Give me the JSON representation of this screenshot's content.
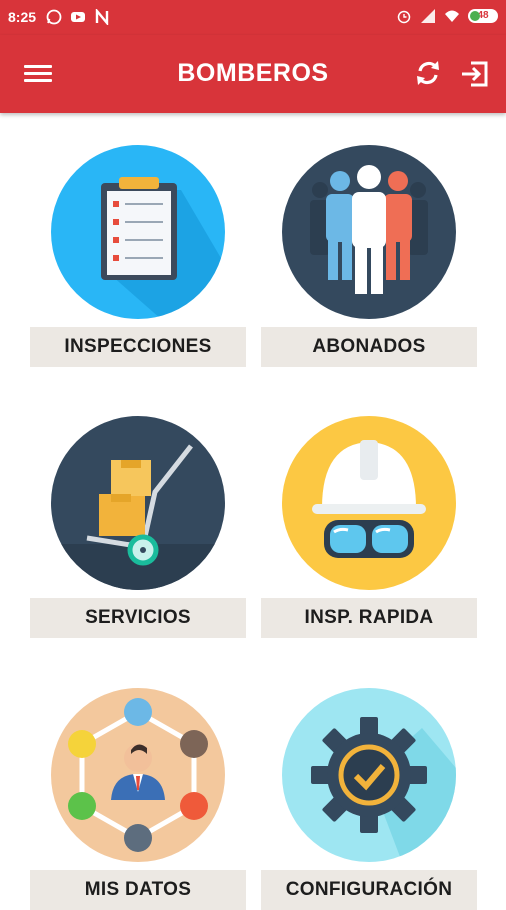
{
  "status_bar": {
    "time": "8:25",
    "battery": "48"
  },
  "app_bar": {
    "title": "BOMBEROS"
  },
  "tiles": [
    {
      "label": "INSPECCIONES",
      "icon": "clipboard-icon",
      "color": "#29b6f6"
    },
    {
      "label": "ABONADOS",
      "icon": "people-group-icon",
      "color": "#34495e"
    },
    {
      "label": "SERVICIOS",
      "icon": "hand-truck-icon",
      "color": "#34495e"
    },
    {
      "label": "INSP. RAPIDA",
      "icon": "helmet-goggles-icon",
      "color": "#fcc843"
    },
    {
      "label": "MIS DATOS",
      "icon": "user-network-icon",
      "color": "#f3c89d"
    },
    {
      "label": "CONFIGURACIÓN",
      "icon": "gear-icon",
      "color": "#9ee6f2"
    }
  ],
  "colors": {
    "primary": "#d8343a",
    "label_bg": "#ece8e3"
  }
}
